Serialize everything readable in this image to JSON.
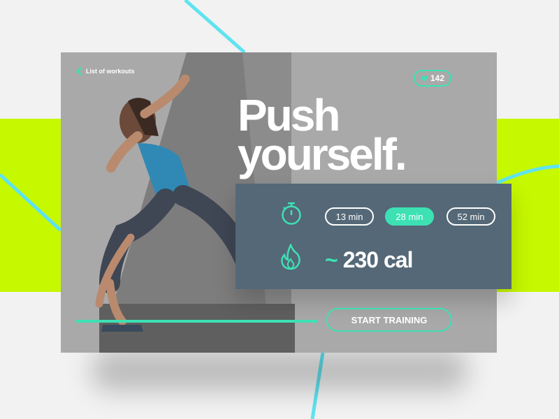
{
  "nav": {
    "back_label": "List of workouts"
  },
  "likes": {
    "count": "142"
  },
  "headline": {
    "line1": "Push",
    "line2": "yourself."
  },
  "durations": [
    {
      "label": "13 min",
      "selected": false
    },
    {
      "label": "28 min",
      "selected": true
    },
    {
      "label": "52 min",
      "selected": false
    }
  ],
  "calories": {
    "prefix": "~",
    "value": "230 cal"
  },
  "actions": {
    "start_label": "START TRAINING"
  },
  "colors": {
    "accent": "#3de1b4",
    "lime": "#c6f800",
    "card": "#a9a9a9",
    "panel": "#546877",
    "line": "#5fe3f0"
  },
  "icons": [
    "chevron-left-icon",
    "heart-icon",
    "stopwatch-icon",
    "flame-icon"
  ]
}
